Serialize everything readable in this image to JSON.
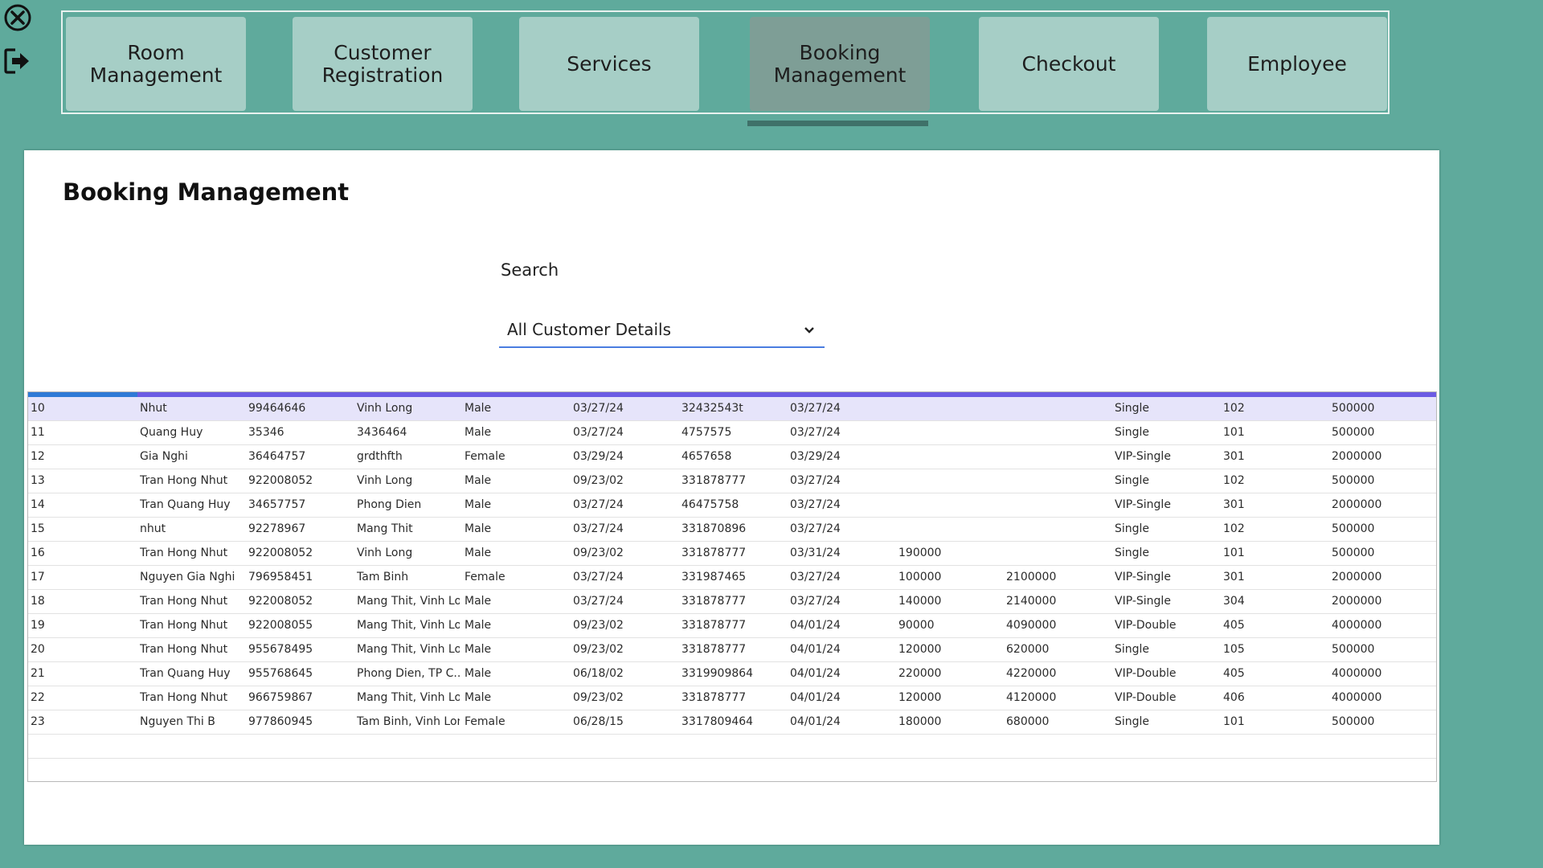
{
  "window": {
    "icons": [
      "close-icon",
      "logout-icon"
    ]
  },
  "nav": {
    "items": [
      {
        "label": "Room\nManagement",
        "active": false
      },
      {
        "label": "Customer\nRegistration",
        "active": false
      },
      {
        "label": "Services",
        "active": false
      },
      {
        "label": "Booking\nManagement",
        "active": true
      },
      {
        "label": "Checkout",
        "active": false
      },
      {
        "label": "Employee",
        "active": false
      }
    ]
  },
  "page": {
    "title": "Booking Management",
    "search_label": "Search",
    "search_selected": "All Customer Details"
  },
  "colors": {
    "background": "#5faa9c",
    "nav_button": "#a6cec6",
    "nav_active": "#7e9e96",
    "underline": "#3f7169",
    "header_bar": "#6b5be3",
    "selected_row": "#e6e4fa"
  },
  "table": {
    "rows": [
      [
        "10",
        "Nhut",
        "99464646",
        "Vinh Long",
        "Male",
        "03/27/24",
        "32432543t",
        "03/27/24",
        "",
        "",
        "Single",
        "102",
        "500000"
      ],
      [
        "11",
        "Quang Huy",
        "35346",
        "3436464",
        "Male",
        "03/27/24",
        "4757575",
        "03/27/24",
        "",
        "",
        "Single",
        "101",
        "500000"
      ],
      [
        "12",
        "Gia Nghi",
        "36464757",
        "grdthfth",
        "Female",
        "03/29/24",
        "4657658",
        "03/29/24",
        "",
        "",
        "VIP-Single",
        "301",
        "2000000"
      ],
      [
        "13",
        "Tran Hong Nhut",
        "922008052",
        "Vinh Long",
        "Male",
        "09/23/02",
        "331878777",
        "03/27/24",
        "",
        "",
        "Single",
        "102",
        "500000"
      ],
      [
        "14",
        "Tran Quang Huy",
        "34657757",
        "Phong Dien",
        "Male",
        "03/27/24",
        "46475758",
        "03/27/24",
        "",
        "",
        "VIP-Single",
        "301",
        "2000000"
      ],
      [
        "15",
        "nhut",
        "92278967",
        "Mang Thit",
        "Male",
        "03/27/24",
        "331870896",
        "03/27/24",
        "",
        "",
        "Single",
        "102",
        "500000"
      ],
      [
        "16",
        "Tran Hong Nhut",
        "922008052",
        "Vinh Long",
        "Male",
        "09/23/02",
        "331878777",
        "03/31/24",
        "190000",
        "",
        "Single",
        "101",
        "500000"
      ],
      [
        "17",
        "Nguyen Gia Nghi",
        "796958451",
        "Tam Binh",
        "Female",
        "03/27/24",
        "331987465",
        "03/27/24",
        "100000",
        "2100000",
        "VIP-Single",
        "301",
        "2000000"
      ],
      [
        "18",
        "Tran Hong Nhut",
        "922008052",
        "Mang Thit, Vinh Lo...",
        "Male",
        "03/27/24",
        "331878777",
        "03/27/24",
        "140000",
        "2140000",
        "VIP-Single",
        "304",
        "2000000"
      ],
      [
        "19",
        "Tran Hong Nhut",
        "922008055",
        "Mang Thit, Vinh Lo...",
        "Male",
        "09/23/02",
        "331878777",
        "04/01/24",
        "90000",
        "4090000",
        "VIP-Double",
        "405",
        "4000000"
      ],
      [
        "20",
        "Tran Hong Nhut",
        "955678495",
        "Mang Thit, Vinh Lo...",
        "Male",
        "09/23/02",
        "331878777",
        "04/01/24",
        "120000",
        "620000",
        "Single",
        "105",
        "500000"
      ],
      [
        "21",
        "Tran Quang Huy",
        "955768645",
        "Phong Dien, TP C...",
        "Male",
        "06/18/02",
        "3319909864",
        "04/01/24",
        "220000",
        "4220000",
        "VIP-Double",
        "405",
        "4000000"
      ],
      [
        "22",
        "Tran Hong Nhut",
        "966759867",
        "Mang Thit, Vinh Lo...",
        "Male",
        "09/23/02",
        "331878777",
        "04/01/24",
        "120000",
        "4120000",
        "VIP-Double",
        "406",
        "4000000"
      ],
      [
        "23",
        "Nguyen Thi B",
        "977860945",
        "Tam Binh, Vinh Long",
        "Female",
        "06/28/15",
        "3317809464",
        "04/01/24",
        "180000",
        "680000",
        "Single",
        "101",
        "500000"
      ]
    ]
  }
}
